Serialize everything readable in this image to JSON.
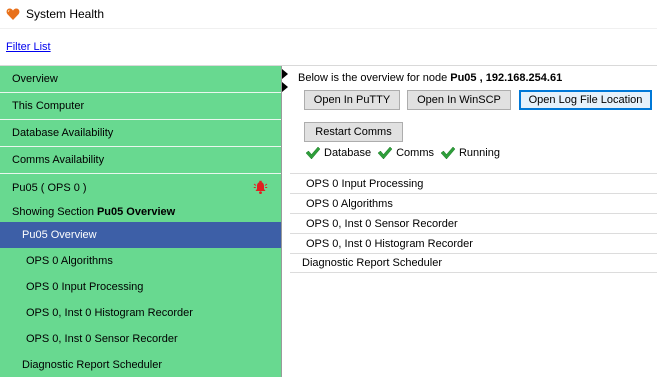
{
  "window": {
    "title": "System Health",
    "icon": "heart-icon"
  },
  "filter": {
    "link_label": "Filter List"
  },
  "sidebar": {
    "items": [
      {
        "label": "Overview"
      },
      {
        "label": "This Computer"
      },
      {
        "label": "Database Availability"
      },
      {
        "label": "Comms Availability"
      }
    ],
    "node": {
      "label": "Pu05 ( OPS 0 )",
      "alarm_icon": "alarm-bell-icon",
      "alarm_color": "#e02020"
    },
    "section": {
      "prefix": "Showing Section",
      "name": "Pu05 Overview"
    },
    "sub_items": [
      {
        "label": "Pu05 Overview",
        "selected": true
      },
      {
        "label": "OPS 0 Algorithms"
      },
      {
        "label": "OPS 0 Input Processing"
      },
      {
        "label": "OPS 0, Inst 0 Histogram Recorder"
      },
      {
        "label": "OPS 0, Inst 0 Sensor Recorder"
      },
      {
        "label": "Diagnostic Report Scheduler"
      }
    ],
    "background_color": "#68d990",
    "selected_color": "#3d5fa7"
  },
  "main": {
    "overview_prefix": "Below is the overview for node",
    "node_name": "Pu05",
    "node_separator": ",",
    "node_ip": "192.168.254.61",
    "buttons": {
      "putty": "Open In PuTTY",
      "winscp": "Open In WinSCP",
      "log": "Open Log File Location",
      "restart": "Restart Comms"
    },
    "status": [
      {
        "label": "Database",
        "icon": "check-icon"
      },
      {
        "label": "Comms",
        "icon": "check-icon"
      },
      {
        "label": "Running",
        "icon": "check-icon"
      }
    ],
    "status_color": "#2e9e3a",
    "list": [
      {
        "label": "OPS 0 Input Processing"
      },
      {
        "label": "OPS 0 Algorithms"
      },
      {
        "label": "OPS 0, Inst 0 Sensor Recorder"
      },
      {
        "label": "OPS 0, Inst 0 Histogram Recorder"
      },
      {
        "label": "Diagnostic Report Scheduler"
      }
    ]
  }
}
